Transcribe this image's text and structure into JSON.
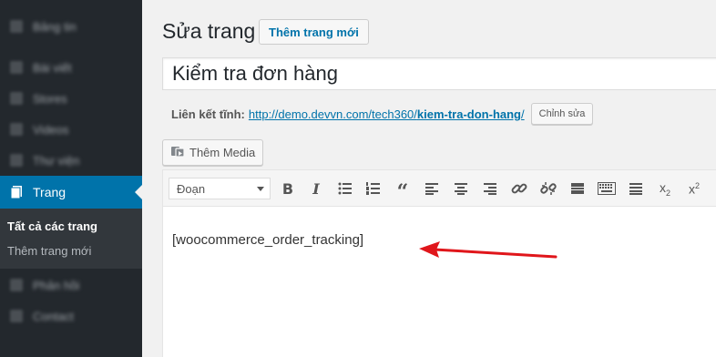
{
  "sidebar": {
    "items": [
      {
        "label": "Bảng tin",
        "icon": "dashboard-icon"
      },
      {
        "label": "Bài viết",
        "icon": "pin-icon"
      },
      {
        "label": "Stores",
        "icon": "store-icon"
      },
      {
        "label": "Videos",
        "icon": "video-icon"
      },
      {
        "label": "Thư viện",
        "icon": "media-icon"
      },
      {
        "label": "Trang",
        "icon": "pages-icon"
      },
      {
        "label": "Phản hồi",
        "icon": "comments-icon"
      },
      {
        "label": "Contact",
        "icon": "contact-icon"
      }
    ],
    "submenu": [
      "Tất cả các trang",
      "Thêm trang mới"
    ]
  },
  "header": {
    "title": "Sửa trang",
    "add_new": "Thêm trang mới"
  },
  "post": {
    "title": "Kiểm tra đơn hàng",
    "permalink_label": "Liên kết tĩnh:",
    "permalink_base": "http://demo.devvn.com/tech360/",
    "permalink_slug": "kiem-tra-don-hang",
    "permalink_tail": "/",
    "edit_slug": "Chỉnh sửa"
  },
  "editor": {
    "add_media": "Thêm Media",
    "format": "Đoạn",
    "content": "[woocommerce_order_tracking]"
  },
  "colors": {
    "sidebar_bg": "#23282d",
    "active_blue": "#0073aa",
    "arrow_red": "#e0161b"
  }
}
